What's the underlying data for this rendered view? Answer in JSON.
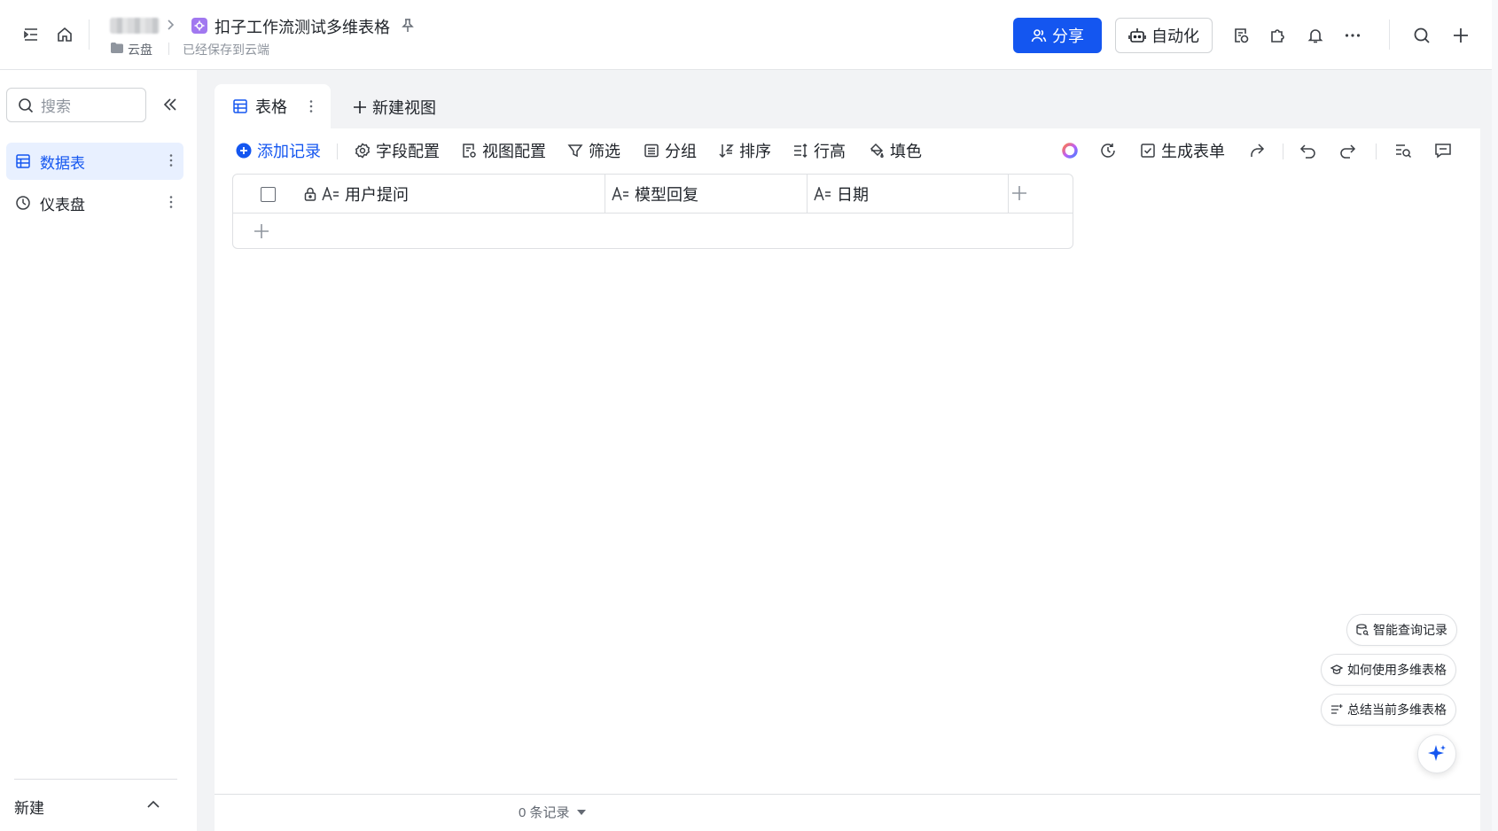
{
  "header": {
    "doc_title": "扣子工作流测试多维表格",
    "folder": "云盘",
    "save_status": "已经保存到云端",
    "share_label": "分享",
    "automation_label": "自动化"
  },
  "sidebar": {
    "search_placeholder": "搜索",
    "items": [
      {
        "label": "数据表",
        "icon": "table-icon",
        "active": true
      },
      {
        "label": "仪表盘",
        "icon": "dashboard-icon",
        "active": false
      }
    ],
    "new_label": "新建"
  },
  "views": {
    "active_tab": "表格",
    "new_view_label": "新建视图"
  },
  "toolbar": {
    "add_record": "添加记录",
    "field_config": "字段配置",
    "view_config": "视图配置",
    "filter": "筛选",
    "group": "分组",
    "sort": "排序",
    "row_height": "行高",
    "fill_color": "填色",
    "generate_form": "生成表单"
  },
  "table": {
    "columns": [
      "用户提问",
      "模型回复",
      "日期"
    ]
  },
  "footer": {
    "record_count": "0 条记录"
  },
  "ai_chips": {
    "smart_query": "智能查询记录",
    "how_to_use": "如何使用多维表格",
    "summarize": "总结当前多维表格"
  },
  "colors": {
    "primary": "#1456f0",
    "sidebar_active_bg": "#e8f0ff",
    "doc_icon": "#a178f0"
  }
}
